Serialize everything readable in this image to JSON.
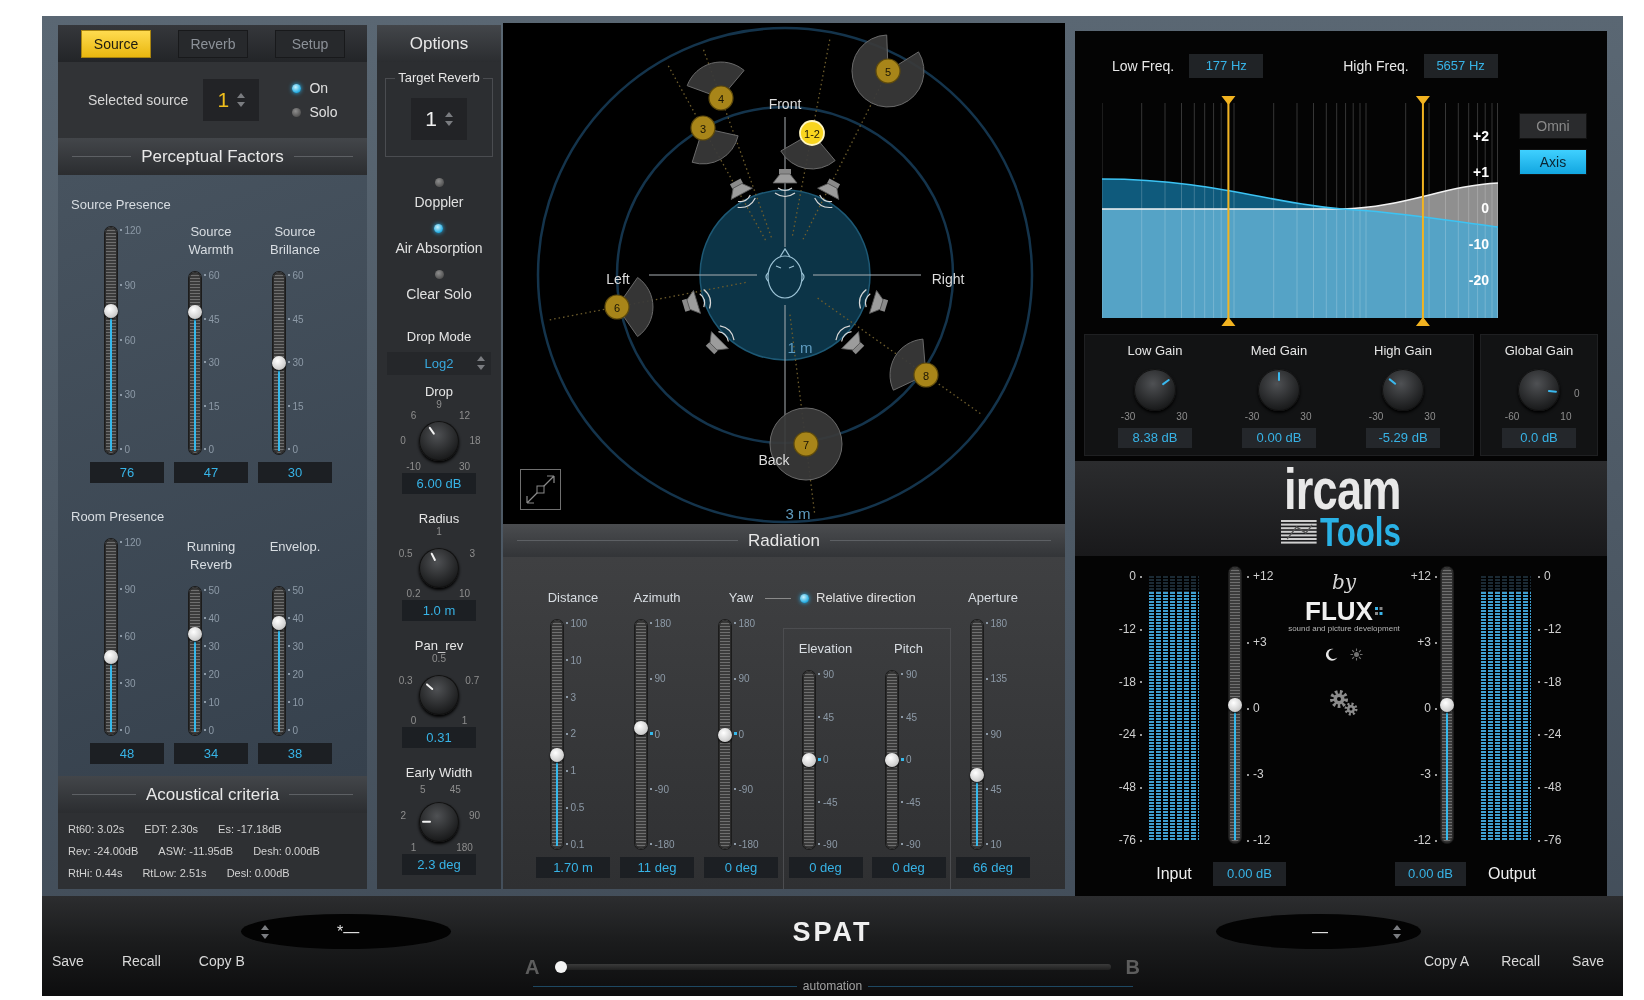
{
  "source_tabs": [
    {
      "label": "Source",
      "selected": true
    },
    {
      "label": "Reverb",
      "selected": false
    },
    {
      "label": "Setup",
      "selected": false
    }
  ],
  "selected_source": {
    "label": "Selected source",
    "value": "1"
  },
  "source_switches": [
    {
      "label": "On",
      "on": true
    },
    {
      "label": "Solo",
      "on": false
    }
  ],
  "perceptual_factors": {
    "title": "Perceptual Factors",
    "groups": [
      {
        "sliders": [
          {
            "label": "Source Presence",
            "ticks": [
              "120",
              "90",
              "60",
              "30",
              "0"
            ],
            "level": 0.63,
            "reading": "76"
          },
          {
            "label": "Source Warmth",
            "ticks": [
              "60",
              "45",
              "30",
              "15",
              "0"
            ],
            "level": 0.78,
            "reading": "47"
          },
          {
            "label": "Source Brillance",
            "ticks": [
              "60",
              "45",
              "30",
              "15",
              "0"
            ],
            "level": 0.5,
            "reading": "30"
          }
        ]
      },
      {
        "sliders": [
          {
            "label": "Room Presence",
            "ticks": [
              "120",
              "90",
              "60",
              "30",
              "0"
            ],
            "level": 0.4,
            "reading": "48"
          },
          {
            "label": "Running Reverb",
            "ticks": [
              "50",
              "40",
              "30",
              "20",
              "10",
              "0"
            ],
            "level": 0.68,
            "reading": "34"
          },
          {
            "label": "Envelop.",
            "ticks": [
              "50",
              "40",
              "30",
              "20",
              "10",
              "0"
            ],
            "level": 0.76,
            "reading": "38"
          }
        ]
      }
    ]
  },
  "acoustical_criteria": {
    "title": "Acoustical criteria",
    "rows": [
      [
        "Rt60: 3.02s",
        "EDT: 2.30s",
        "Es: -17.18dB"
      ],
      [
        "Rev: -24.00dB",
        "ASW: -11.95dB",
        "Desh: 0.00dB"
      ],
      [
        "RtHi: 0.44s",
        "RtLow: 2.51s",
        "Desl: 0.00dB"
      ]
    ]
  },
  "options": {
    "title": "Options",
    "target_reverb": {
      "label": "Target Reverb",
      "value": "1"
    },
    "switches": [
      {
        "label": "Doppler",
        "on": false
      },
      {
        "label": "Air Absorption",
        "on": true
      },
      {
        "label": "Clear Solo",
        "on": false
      }
    ],
    "drop_mode": {
      "label": "Drop Mode",
      "value": "Log2"
    },
    "knobs": [
      {
        "label": "Drop",
        "ticks": [
          "-10",
          "0",
          "6",
          "9",
          "12",
          "18",
          "30"
        ],
        "level": 0.37,
        "reading": "6.00 dB"
      },
      {
        "label": "Radius",
        "ticks": [
          "0.2",
          "0.5",
          "1",
          "3",
          "10"
        ],
        "level": 0.4,
        "reading": "1.0 m"
      },
      {
        "label": "Pan_rev",
        "ticks": [
          "0",
          "0.3",
          "0.5",
          "0.7",
          "1"
        ],
        "level": 0.32,
        "reading": "0.31"
      },
      {
        "label": "Early Width",
        "ticks": [
          "1",
          "2",
          "5",
          "45",
          "90",
          "180"
        ],
        "level": 0.17,
        "reading": "2.3 deg"
      }
    ]
  },
  "spatial": {
    "axis_labels": [
      "Front",
      "Left",
      "Right",
      "Back"
    ],
    "distance_labels": [
      "1 m",
      "3 m"
    ],
    "sources": [
      {
        "label": "1-2",
        "selected": true
      },
      {
        "label": "3",
        "selected": false
      },
      {
        "label": "4",
        "selected": false
      },
      {
        "label": "5",
        "selected": false
      },
      {
        "label": "6",
        "selected": false
      },
      {
        "label": "7",
        "selected": false
      },
      {
        "label": "8",
        "selected": false
      }
    ]
  },
  "radiation": {
    "title": "Radiation",
    "sliders": [
      {
        "label": "Distance",
        "kind": "unipolar",
        "ticks": [
          "100",
          "10",
          "3",
          "2",
          "1",
          "0.5",
          "0.1"
        ],
        "level": 0.41,
        "reading": "1.70 m"
      },
      {
        "label": "Azimuth",
        "kind": "bipolar",
        "ticks": [
          "180",
          "90",
          "0",
          "-90",
          "-180"
        ],
        "level": 0.53,
        "reading": "11 deg"
      },
      {
        "label": "Yaw",
        "kind": "bipolar",
        "ticks": [
          "180",
          "90",
          "0",
          "-90",
          "-180"
        ],
        "level": 0.5,
        "reading": "0 deg"
      }
    ],
    "relative_direction": {
      "label": "Relative direction",
      "on": true
    },
    "elevation_pitch": [
      {
        "label": "Elevation",
        "kind": "bipolar",
        "ticks": [
          "90",
          "45",
          "0",
          "-45",
          "-90"
        ],
        "level": 0.5,
        "reading": "0 deg"
      },
      {
        "label": "Pitch",
        "kind": "bipolar",
        "ticks": [
          "90",
          "45",
          "0",
          "-45",
          "-90"
        ],
        "level": 0.5,
        "reading": "0 deg"
      }
    ],
    "aperture": {
      "label": "Aperture",
      "kind": "unipolar",
      "ticks": [
        "180",
        "135",
        "90",
        "45",
        "10"
      ],
      "level": 0.325,
      "reading": "66 deg"
    }
  },
  "eq": {
    "low_freq": {
      "label": "Low Freq.",
      "value": "177 Hz",
      "level": 0.316
    },
    "high_freq": {
      "label": "High Freq.",
      "value": "5657 Hz",
      "level": 0.816
    },
    "scale": [
      "+2",
      "+1",
      "0",
      "-10",
      "-20"
    ],
    "modes": [
      {
        "label": "Omni",
        "selected": false
      },
      {
        "label": "Axis",
        "selected": true
      }
    ],
    "band_gains": [
      {
        "label": "Low Gain",
        "ticks": [
          "-30",
          "30"
        ],
        "level": 0.7,
        "reading": "8.38 dB"
      },
      {
        "label": "Med Gain",
        "ticks": [
          "-30",
          "30"
        ],
        "level": 0.5,
        "reading": "0.00 dB"
      },
      {
        "label": "High Gain",
        "ticks": [
          "-30",
          "30"
        ],
        "level": 0.31,
        "reading": "-5.29 dB"
      }
    ],
    "global_gain": {
      "label": "Global Gain",
      "ticks": [
        "-60",
        "10"
      ],
      "marker_label": "0",
      "level": 0.855,
      "reading": "0.0 dB"
    }
  },
  "logo": {
    "brand": "ircam",
    "product": "Tools"
  },
  "vendor": {
    "by": "by",
    "name": "FLUX",
    "tagline": "sound and picture development"
  },
  "input": {
    "label": "Input",
    "meter": {
      "scale": [
        "0",
        "-12",
        "-18",
        "-24",
        "-48",
        "-76"
      ],
      "level": 0.94
    },
    "gain": {
      "scale": [
        "+12",
        "+3",
        "0",
        "-3",
        "-12"
      ],
      "level": 0.5,
      "reading": "0.00 dB"
    }
  },
  "output": {
    "label": "Output",
    "gain": {
      "scale": [
        "+12",
        "+3",
        "0",
        "-3",
        "-12"
      ],
      "level": 0.5,
      "reading": "0.00 dB"
    },
    "meter": {
      "scale": [
        "0",
        "-12",
        "-18",
        "-24",
        "-48",
        "-76"
      ],
      "level": 0.94
    }
  },
  "preset_bar": {
    "left_buttons": [
      "Save",
      "Recall",
      "Copy B"
    ],
    "preset_a": "*—",
    "title": "SPAT",
    "preset_b": "—",
    "right_buttons": [
      "Copy A",
      "Recall",
      "Save"
    ],
    "morph": {
      "start": "A",
      "end": "B",
      "level": 0,
      "label": "automation"
    }
  }
}
